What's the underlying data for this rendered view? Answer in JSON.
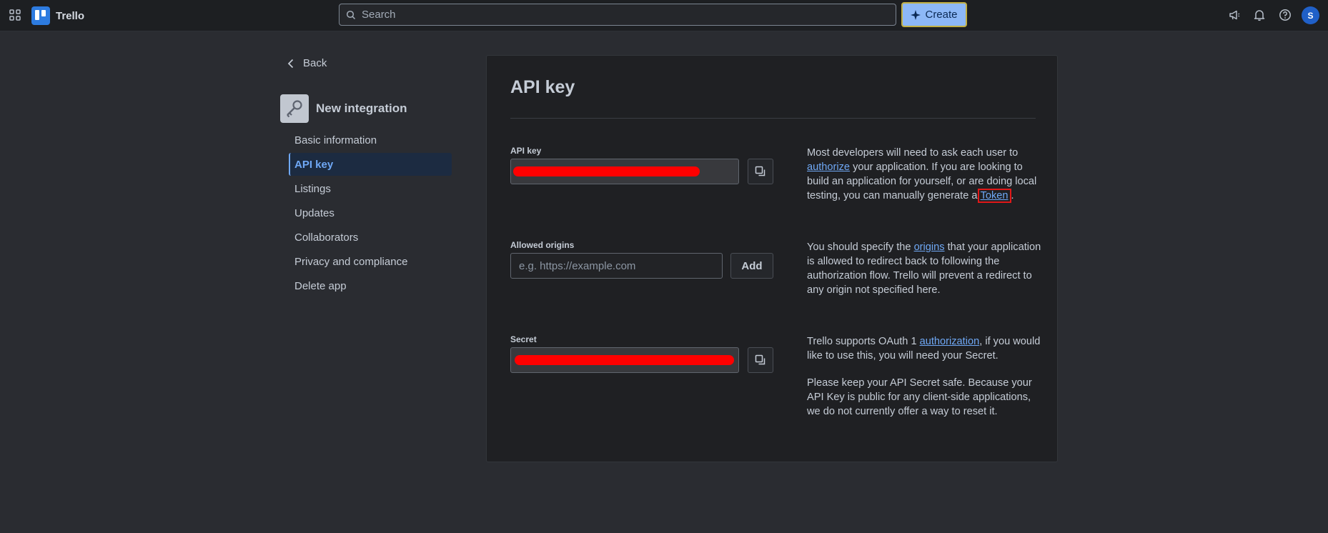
{
  "header": {
    "app_name": "Trello",
    "search_placeholder": "Search",
    "create_label": "Create",
    "avatar_initial": "S"
  },
  "sidebar": {
    "back_label": "Back",
    "integration_name": "New integration",
    "items": [
      {
        "label": "Basic information",
        "active": false
      },
      {
        "label": "API key",
        "active": true
      },
      {
        "label": "Listings",
        "active": false
      },
      {
        "label": "Updates",
        "active": false
      },
      {
        "label": "Collaborators",
        "active": false
      },
      {
        "label": "Privacy and compliance",
        "active": false
      },
      {
        "label": "Delete app",
        "active": false
      }
    ]
  },
  "main": {
    "title": "API key",
    "api_key": {
      "label": "API key",
      "help": {
        "p1_before": "Most developers will need to ask each user to ",
        "p1_link": "authorize",
        "p1_middle": " your application. If you are looking to build an application for yourself, or are doing local testing, you can manually generate a ",
        "p1_token": "Token",
        "p1_after": "."
      }
    },
    "allowed_origins": {
      "label": "Allowed origins",
      "placeholder": "e.g. https://example.com",
      "add_label": "Add",
      "help": {
        "before": "You should specify the ",
        "link": "origins",
        "after": " that your application is allowed to redirect back to following the authorization flow. Trello will prevent a redirect to any origin not specified here."
      }
    },
    "secret": {
      "label": "Secret",
      "help": {
        "p1_before": "Trello supports OAuth 1 ",
        "p1_link": "authorization",
        "p1_after": ", if you would like to use this, you will need your Secret.",
        "p2": "Please keep your API Secret safe. Because your API Key is public for any client-side applications, we do not currently offer a way to reset it."
      }
    }
  },
  "colors": {
    "background": "#2a2c31",
    "card": "#1f2023",
    "link": "#6fa8f5",
    "redaction": "#ff0000",
    "highlight_box": "#e01818"
  }
}
